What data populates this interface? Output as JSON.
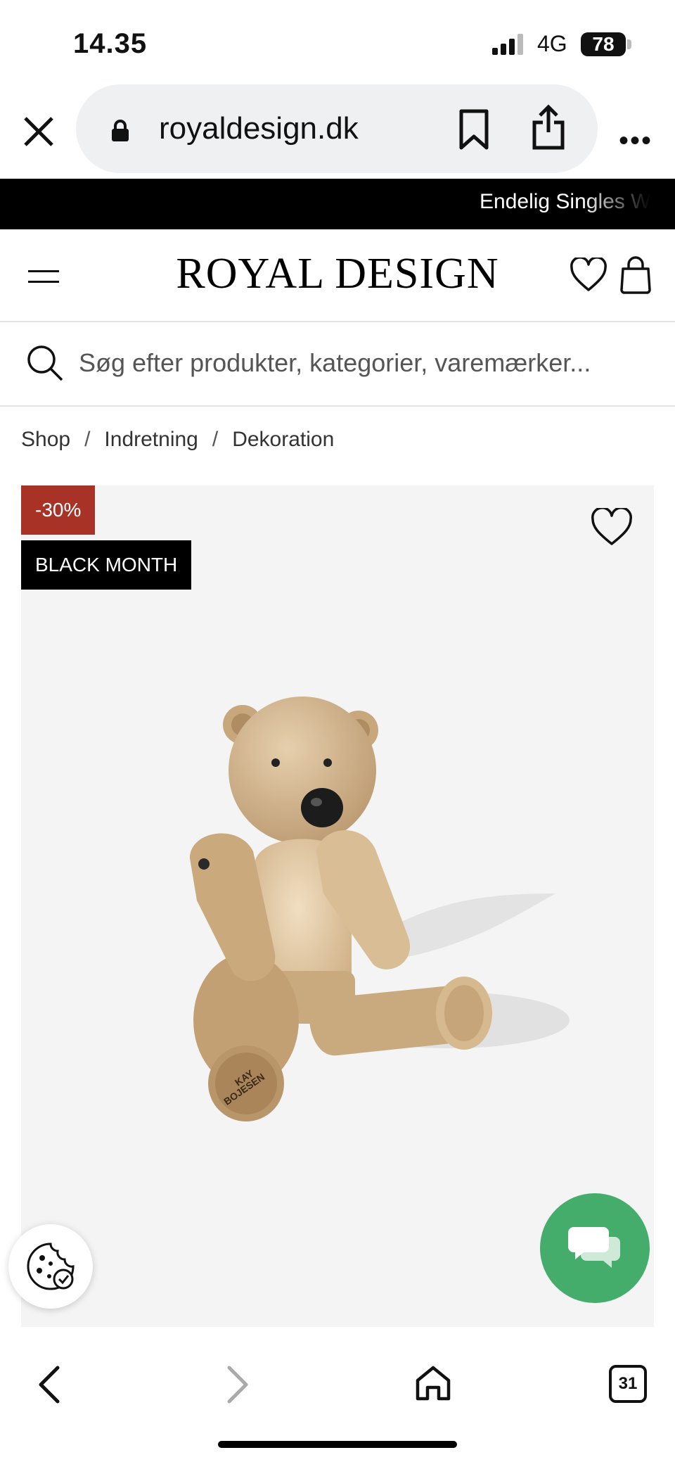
{
  "status_bar": {
    "time": "14.35",
    "network": "4G",
    "battery": "78"
  },
  "browser": {
    "url": "royaldesign.dk"
  },
  "promo": {
    "text": "Endelig Singles W"
  },
  "header": {
    "logo": "ROYAL DESIGN"
  },
  "search": {
    "placeholder": "Søg efter produkter, kategorier, varemærker..."
  },
  "breadcrumb": [
    "Shop",
    "Indretning",
    "Dekoration"
  ],
  "product": {
    "badges": {
      "discount": "-30%",
      "campaign": "BLACK MONTH"
    },
    "engraving": "KAY BOJESEN"
  },
  "toolbar": {
    "tab_count": "31"
  },
  "colors": {
    "sale_badge": "#a83226",
    "chat_button": "#45ad6c",
    "promo_bg": "#000000"
  }
}
